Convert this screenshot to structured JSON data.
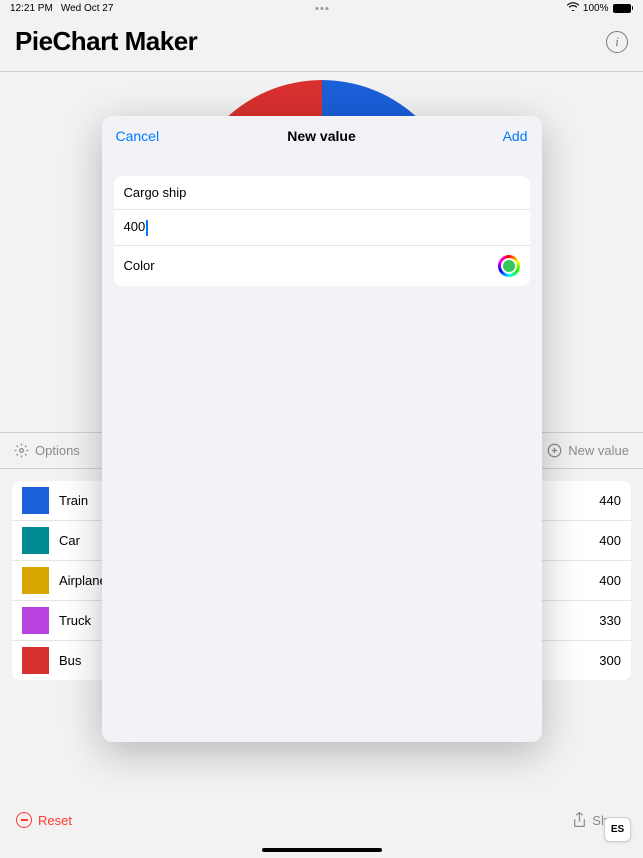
{
  "status": {
    "time": "12:21 PM",
    "date": "Wed Oct 27",
    "battery": "100%"
  },
  "app": {
    "title": "PieChart Maker"
  },
  "toolbar": {
    "options": "Options",
    "new_value": "New value"
  },
  "items": [
    {
      "label": "Train",
      "value": "440",
      "color": "#1b5fd9"
    },
    {
      "label": "Car",
      "value": "400",
      "color": "#008b95"
    },
    {
      "label": "Airplane",
      "value": "400",
      "color": "#d9a500"
    },
    {
      "label": "Truck",
      "value": "330",
      "color": "#b941e0"
    },
    {
      "label": "Bus",
      "value": "300",
      "color": "#d93030"
    }
  ],
  "bottom": {
    "reset": "Reset",
    "share": "Share"
  },
  "modal": {
    "cancel": "Cancel",
    "title": "New value",
    "add": "Add",
    "name_value": "Cargo ship",
    "amount_value": "400",
    "color_label": "Color",
    "picked_color": "#34c759"
  },
  "es_badge": "ES",
  "chart_data": {
    "type": "pie",
    "title": "",
    "series": [
      {
        "name": "Train",
        "value": 440,
        "color": "#1b5fd9"
      },
      {
        "name": "Car",
        "value": 400,
        "color": "#008b95"
      },
      {
        "name": "Airplane",
        "value": 400,
        "color": "#d9a500"
      },
      {
        "name": "Truck",
        "value": 330,
        "color": "#b941e0"
      },
      {
        "name": "Bus",
        "value": 300,
        "color": "#d93030"
      }
    ]
  }
}
